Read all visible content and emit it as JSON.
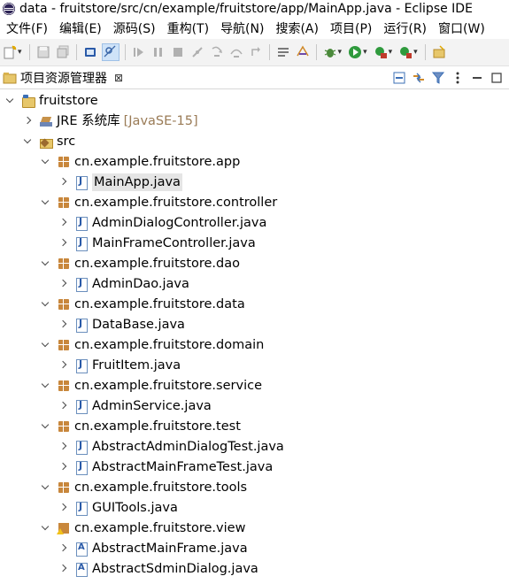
{
  "window": {
    "title": "data - fruitstore/src/cn/example/fruitstore/app/MainApp.java - Eclipse IDE"
  },
  "menu": [
    "文件(F)",
    "编辑(E)",
    "源码(S)",
    "重构(T)",
    "导航(N)",
    "搜索(A)",
    "项目(P)",
    "运行(R)",
    "窗口(W)"
  ],
  "view": {
    "title": "项目资源管理器",
    "close": "⊠"
  },
  "tree": {
    "project": "fruitstore",
    "jre": {
      "label": "JRE 系统库",
      "suffix": "[JavaSE-15]"
    },
    "src": "src",
    "packages": [
      {
        "name": "cn.example.fruitstore.app",
        "files": [
          "MainApp.java"
        ]
      },
      {
        "name": "cn.example.fruitstore.controller",
        "files": [
          "AdminDialogController.java",
          "MainFrameController.java"
        ]
      },
      {
        "name": "cn.example.fruitstore.dao",
        "files": [
          "AdminDao.java"
        ]
      },
      {
        "name": "cn.example.fruitstore.data",
        "files": [
          "DataBase.java"
        ]
      },
      {
        "name": "cn.example.fruitstore.domain",
        "files": [
          "FruitItem.java"
        ]
      },
      {
        "name": "cn.example.fruitstore.service",
        "files": [
          "AdminService.java"
        ]
      },
      {
        "name": "cn.example.fruitstore.test",
        "files": [
          "AbstractAdminDialogTest.java",
          "AbstractMainFrameTest.java"
        ]
      },
      {
        "name": "cn.example.fruitstore.tools",
        "files": [
          "GUITools.java"
        ]
      },
      {
        "name": "cn.example.fruitstore.view",
        "files": [
          "AbstractMainFrame.java",
          "AbstractSdminDialog.java"
        ]
      }
    ]
  }
}
